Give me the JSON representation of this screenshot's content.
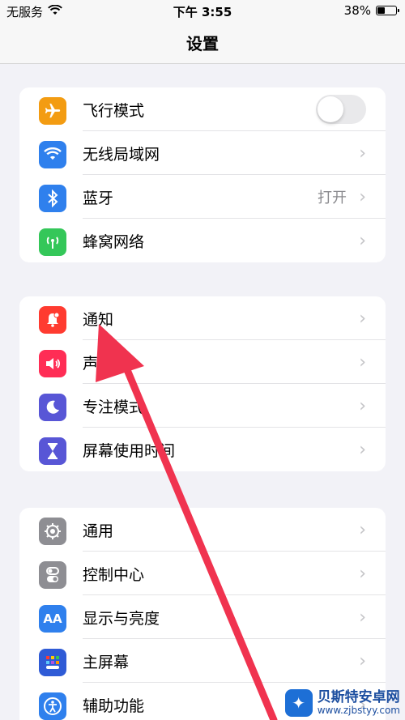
{
  "status_bar": {
    "carrier": "无服务",
    "time": "下午 3:55",
    "battery": "38%"
  },
  "nav": {
    "title": "设置"
  },
  "groups": [
    {
      "items": [
        {
          "label": "飞行模式",
          "icon": "airplane-icon",
          "color": "#f39c12",
          "toggle": false
        },
        {
          "label": "无线局域网",
          "icon": "wifi-icon",
          "color": "#2f80ed"
        },
        {
          "label": "蓝牙",
          "icon": "bluetooth-icon",
          "color": "#2f80ed",
          "value": "打开"
        },
        {
          "label": "蜂窝网络",
          "icon": "antenna-icon",
          "color": "#34c759"
        }
      ]
    },
    {
      "items": [
        {
          "label": "通知",
          "icon": "bell-icon",
          "color": "#ff3b30"
        },
        {
          "label": "声音",
          "icon": "speaker-icon",
          "color": "#ff2d55"
        },
        {
          "label": "专注模式",
          "icon": "moon-icon",
          "color": "#5856d6"
        },
        {
          "label": "屏幕使用时间",
          "icon": "hourglass-icon",
          "color": "#5856d6"
        }
      ]
    },
    {
      "items": [
        {
          "label": "通用",
          "icon": "gear-icon",
          "color": "#8e8e93"
        },
        {
          "label": "控制中心",
          "icon": "toggles-icon",
          "color": "#8e8e93"
        },
        {
          "label": "显示与亮度",
          "icon": "aa-icon",
          "color": "#2f80ed"
        },
        {
          "label": "主屏幕",
          "icon": "grid-icon",
          "color": "#2f5bd6"
        },
        {
          "label": "辅助功能",
          "icon": "accessibility-icon",
          "color": "#2f80ed"
        }
      ]
    }
  ],
  "watermark": {
    "line1": "贝斯特安卓网",
    "line2": "www.zjbstyy.com"
  }
}
